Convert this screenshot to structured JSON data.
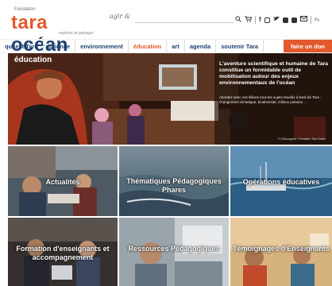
{
  "header": {
    "logo_top": "Fondation",
    "logo_word1": "tara",
    "logo_word2": "océan",
    "logo_sub": "explorer et partager",
    "tagline": "agir &"
  },
  "nav": {
    "items": [
      {
        "label": "qui est Tara"
      },
      {
        "label": "science"
      },
      {
        "label": "environnement"
      },
      {
        "label": "éducation",
        "active": true
      },
      {
        "label": "art"
      },
      {
        "label": "agenda"
      },
      {
        "label": "soutenir Tara"
      }
    ],
    "cta": "faire un don"
  },
  "hero": {
    "title": "éducation",
    "heading": "L'aventure scientifique et humaine de Tara constitue un formidable outil de mobilisation autour des enjeux environnementaux de l'océan",
    "sub": "Abordez avec vos élèves tous les sujets étudiés à bord de Tara : changement climatique, biodiversité, milieux polaires ...",
    "credit": "© N.Bourgeois / Fondation Tara Océan"
  },
  "tiles": [
    {
      "label": "Actualités"
    },
    {
      "label": "Thématiques Pédagogiques Phares"
    },
    {
      "label": "Opérations éducatives"
    },
    {
      "label": "Formation d'enseignants et accompagnement"
    },
    {
      "label": "Ressources Pédagogiques"
    },
    {
      "label": "Témoignages d'Enseignants"
    }
  ],
  "colors": {
    "brand_orange": "#e2592c",
    "brand_navy": "#1f3f70"
  }
}
